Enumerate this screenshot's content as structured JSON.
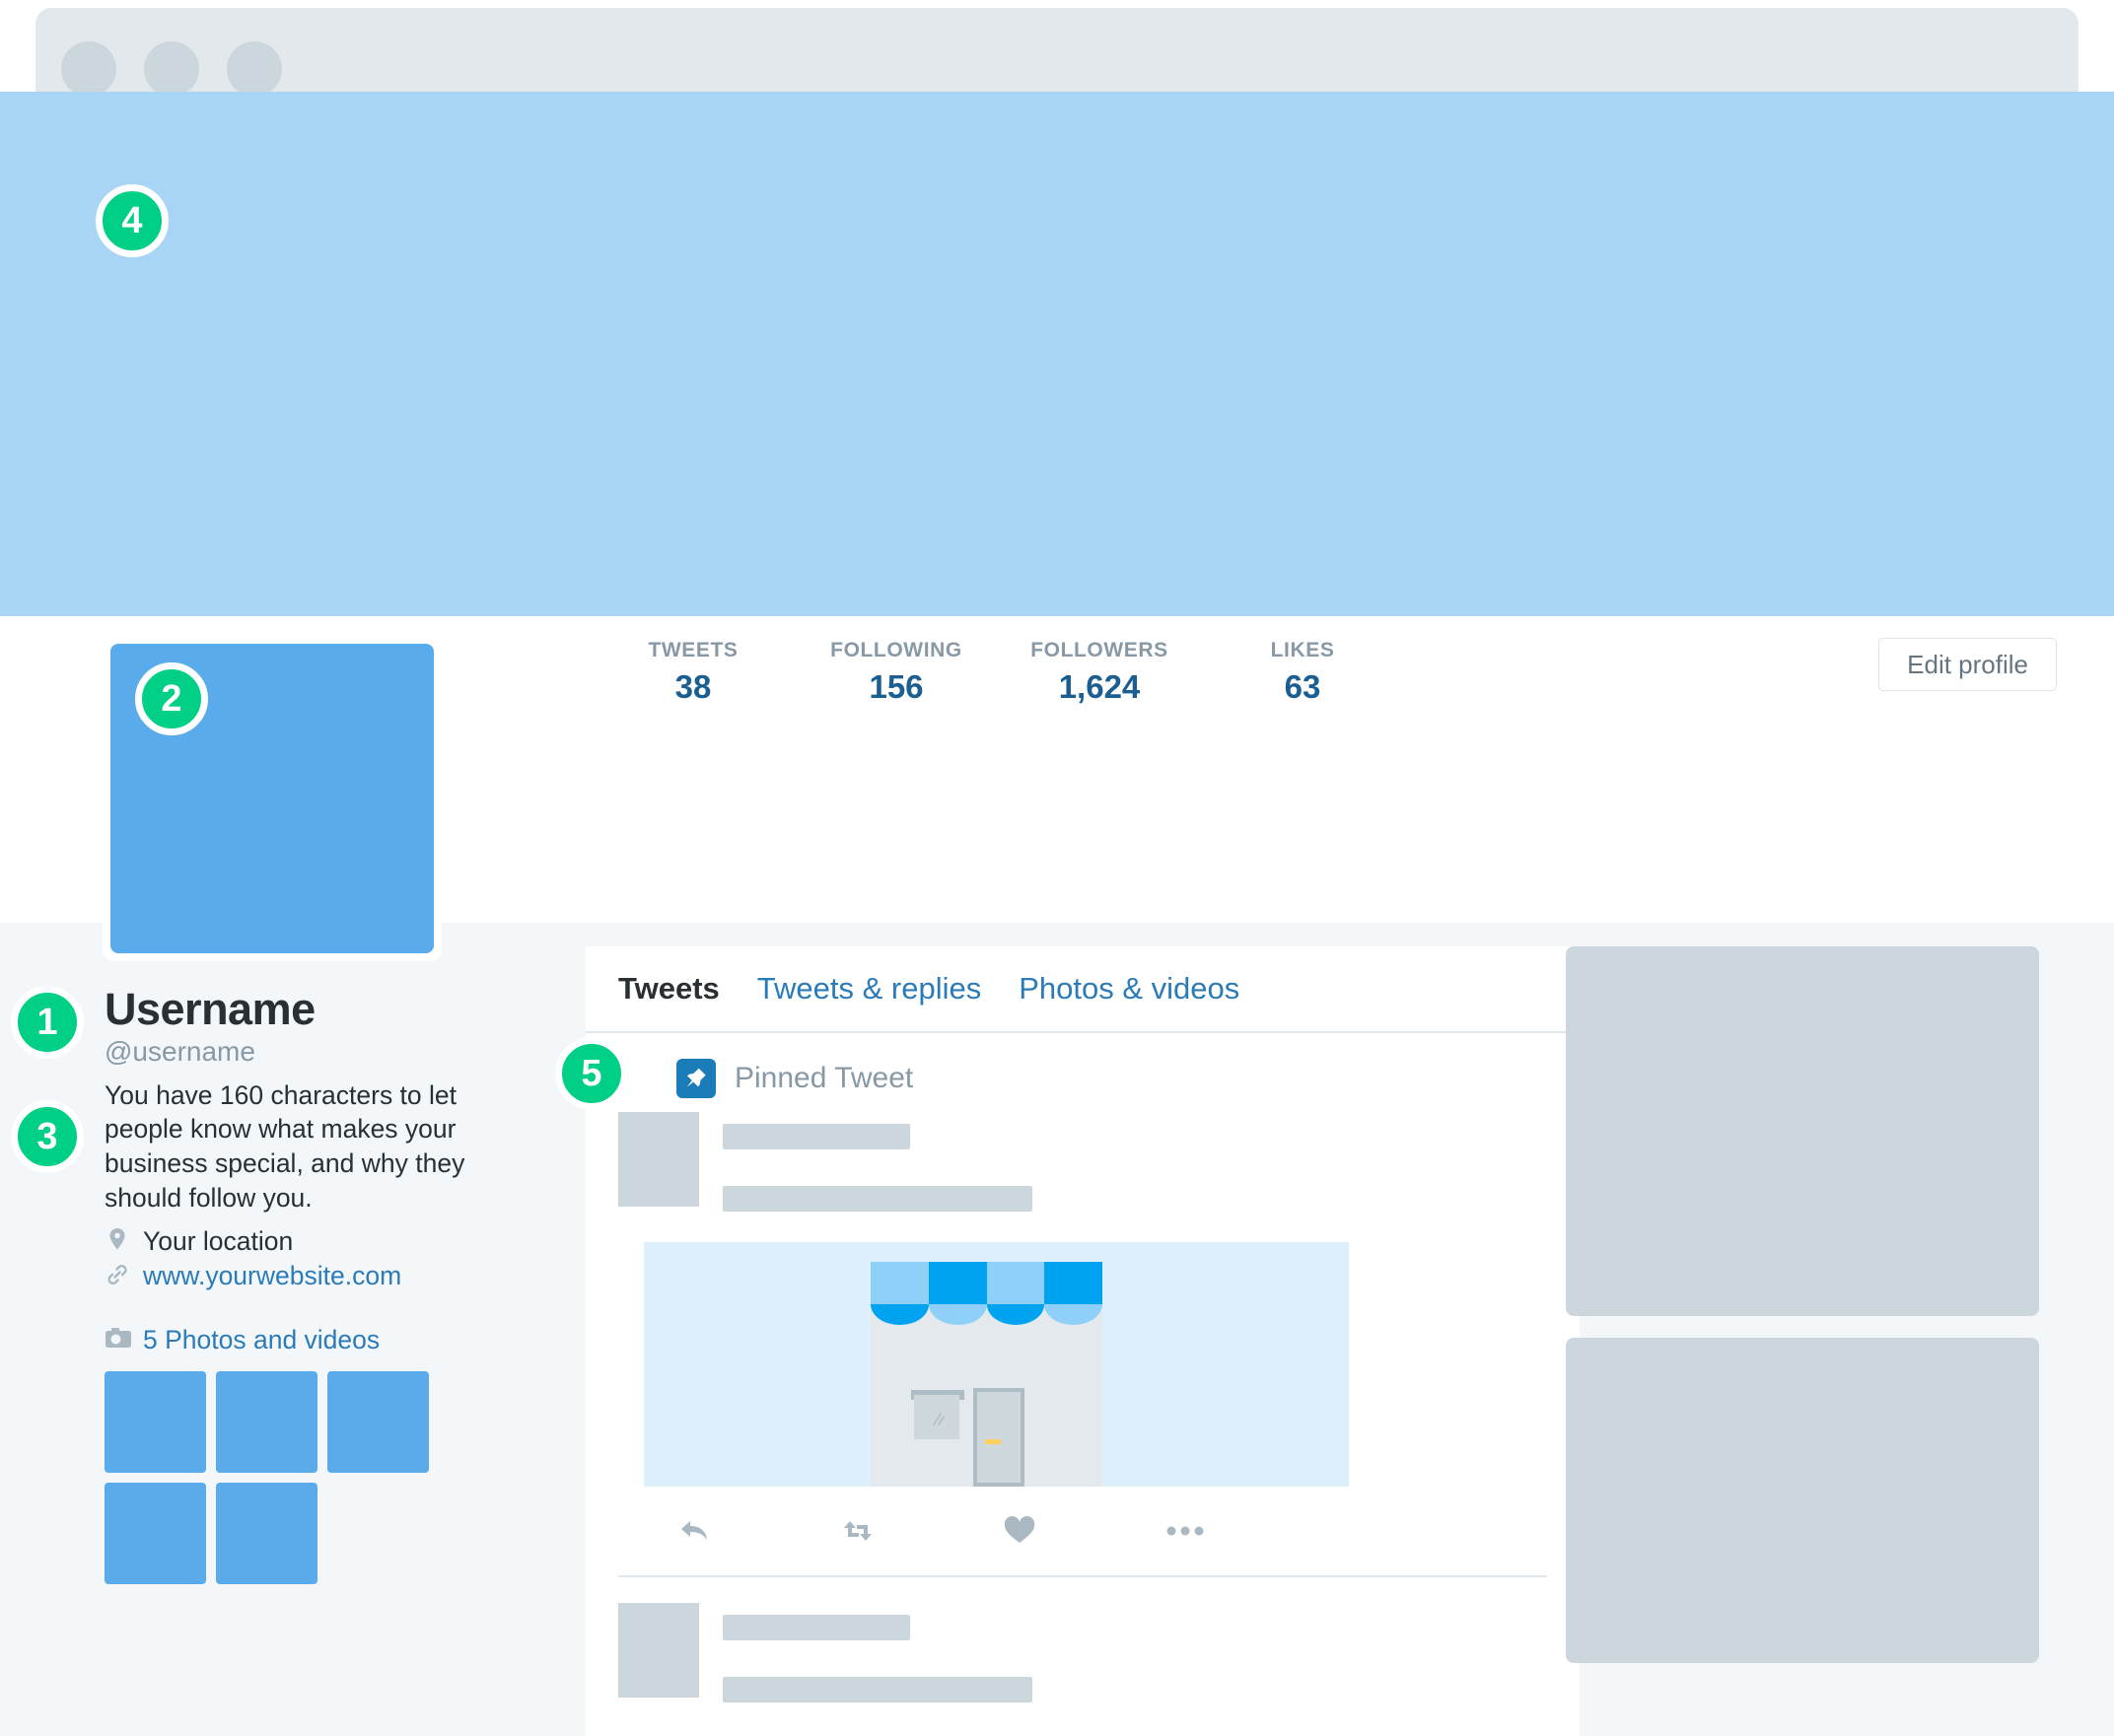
{
  "window": {
    "dots": [
      "traffic-light-1",
      "traffic-light-2",
      "traffic-light-3"
    ]
  },
  "profile": {
    "display_name": "Username",
    "handle": "@username",
    "bio": "You have 160 characters to let people know what makes your business special, and why they should follow you.",
    "location": "Your location",
    "website": "www.yourwebsite.com",
    "photos_label": "5 Photos and videos",
    "edit_button": "Edit profile",
    "photo_tiles": [
      "photo-1",
      "photo-2",
      "photo-3",
      "photo-4",
      "photo-5"
    ]
  },
  "stats": [
    {
      "label": "TWEETS",
      "value": "38"
    },
    {
      "label": "FOLLOWING",
      "value": "156"
    },
    {
      "label": "FOLLOWERS",
      "value": "1,624"
    },
    {
      "label": "LIKES",
      "value": "63"
    }
  ],
  "tabs": [
    {
      "label": "Tweets",
      "active": true
    },
    {
      "label": "Tweets & replies",
      "active": false
    },
    {
      "label": "Photos & videos",
      "active": false
    }
  ],
  "timeline": {
    "pinned_label": "Pinned Tweet",
    "actions": [
      "reply-icon",
      "retweet-icon",
      "like-icon",
      "more-icon"
    ]
  },
  "callouts": [
    {
      "number": "1",
      "target": "display-name"
    },
    {
      "number": "2",
      "target": "avatar"
    },
    {
      "number": "3",
      "target": "bio"
    },
    {
      "number": "4",
      "target": "header-banner"
    },
    {
      "number": "5",
      "target": "pinned-tweet"
    }
  ],
  "colors": {
    "accent_green": "#00cf86",
    "banner_blue": "#a8d4f5",
    "avatar_blue": "#5aabeb",
    "link_blue": "#2b7bb9",
    "stat_value_blue": "#1b5e91",
    "muted_grey": "#8899a6",
    "placeholder_grey": "#ccd6dd",
    "page_bg": "#f3f7f9",
    "media_bg": "#ddf0fc",
    "awning_dark": "#00a3f0",
    "awning_light": "#8ed0f7",
    "door_handle_yellow": "#ffd15c"
  }
}
